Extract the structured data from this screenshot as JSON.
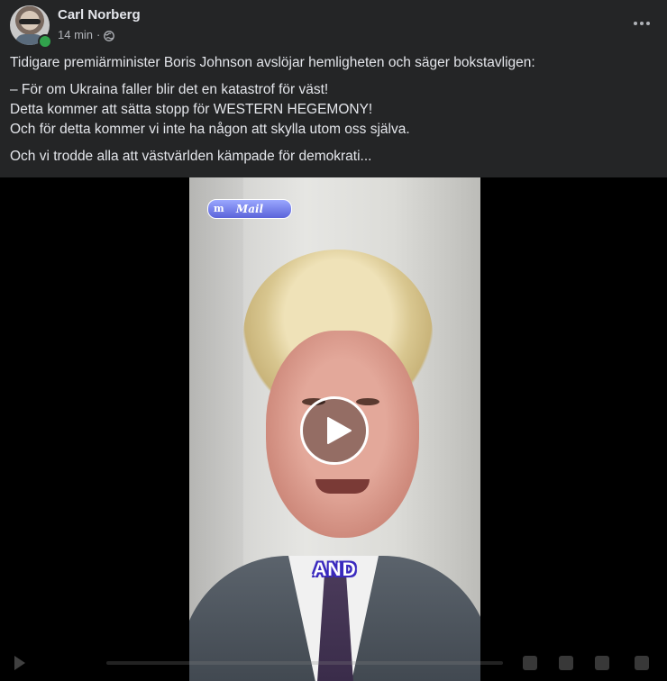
{
  "post": {
    "author": "Carl Norberg",
    "time": "14 min",
    "separator": "·",
    "audience_icon": "globe-icon",
    "more_icon": "more-options-icon",
    "text": {
      "line1": "Tidigare premiärminister Boris Johnson avslöjar hemligheten och säger bokstavligen:",
      "line2": "– För om Ukraina faller blir det en katastrof för väst!",
      "line3": "Detta kommer att sätta stopp för WESTERN HEGEMONY!",
      "line4": "Och för detta kommer vi inte ha någon att skylla utom oss själva.",
      "line5": "Och vi trodde alla att västvärlden kämpade för demokrati..."
    }
  },
  "video": {
    "watermark": "Mail",
    "watermark_logo": "m",
    "caption": "AND",
    "play_icon": "play-icon"
  },
  "colors": {
    "background": "#242526",
    "text": "#e4e6eb",
    "secondary_text": "#b0b3b8",
    "online": "#31a24c"
  }
}
